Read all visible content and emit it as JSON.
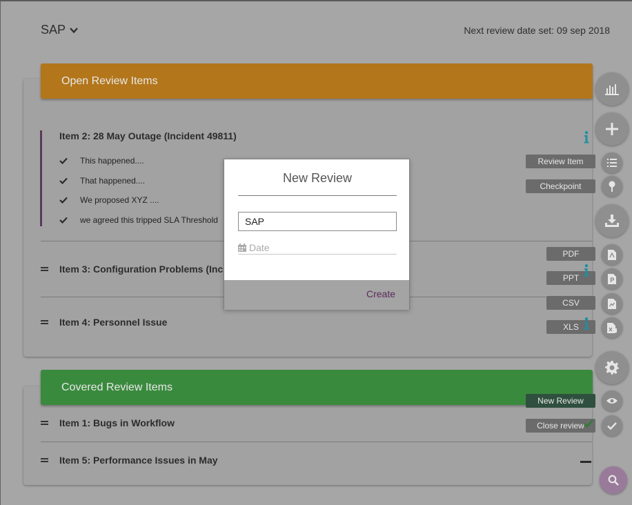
{
  "topbar": {
    "app_name": "SAP",
    "next_review": "Next review date set: 09 sep 2018"
  },
  "open_section": {
    "title": "Open Review Items",
    "color": "#b3761b",
    "items": [
      {
        "title": "Item 2: 28 May Outage (Incident 49811)",
        "points": [
          "This happened....",
          "That happened....",
          "We proposed XYZ ....",
          "we agreed this tripped SLA Threshold"
        ]
      },
      {
        "title": "Item 3: Configuration Problems (Inc"
      },
      {
        "title": "Item 4: Personnel Issue"
      }
    ]
  },
  "covered_section": {
    "title": "Covered Review Items",
    "color": "#3a8a3e",
    "items": [
      {
        "title": "Item 1: Bugs in Workflow"
      },
      {
        "title": "Item 5: Performance Issues in May"
      }
    ]
  },
  "fab_menu": {
    "review_item_label": "Review Item",
    "checkpoint_label": "Checkpoint",
    "pdf_label": "PDF",
    "ppt_label": "PPT",
    "csv_label": "CSV",
    "xls_label": "XLS",
    "new_review_label": "New Review",
    "close_review_label": "Close review"
  },
  "modal": {
    "title": "New Review",
    "input_value": "SAP",
    "date_placeholder": "Date",
    "create_label": "Create"
  },
  "colors": {
    "info": "#1f8fa0",
    "accent": "#5a2a5a"
  }
}
